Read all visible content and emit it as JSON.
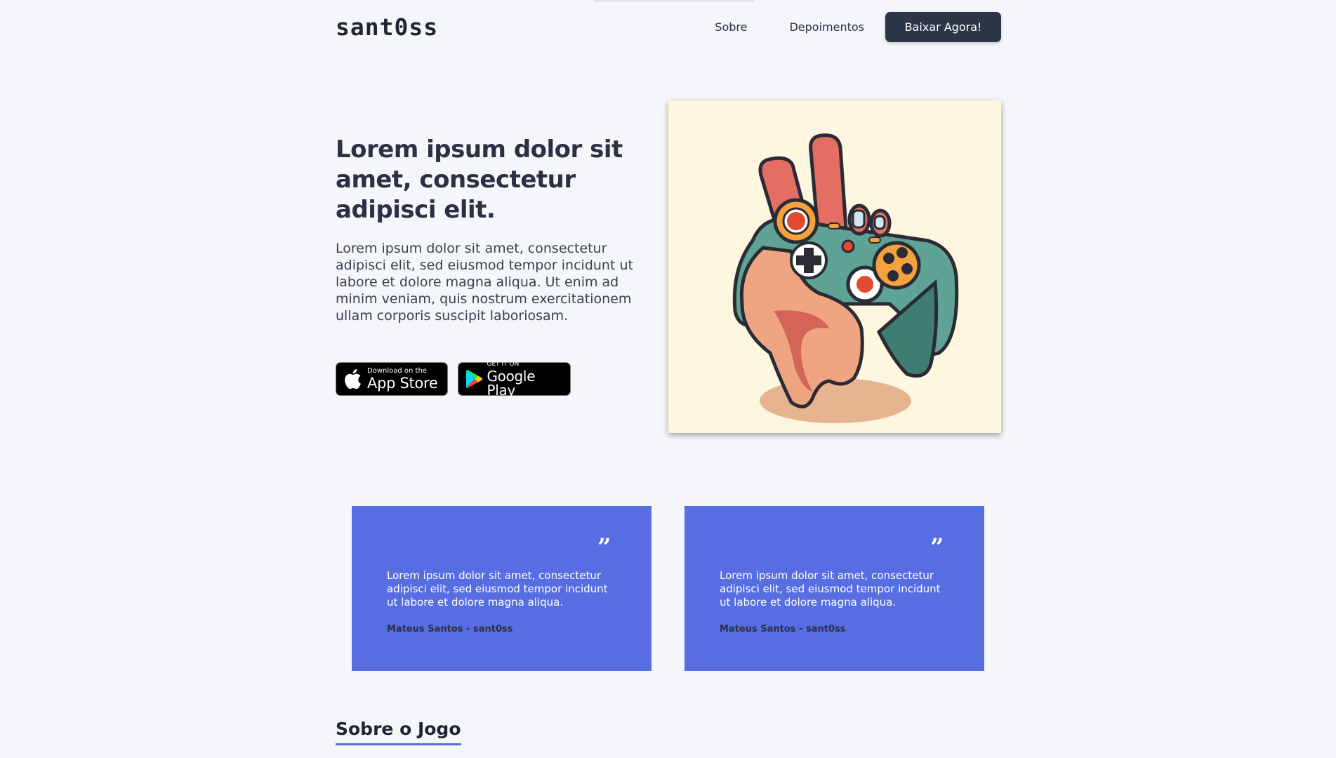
{
  "header": {
    "logo": "sant0ss",
    "nav": [
      "Sobre",
      "Depoimentos"
    ],
    "cta_label": "Baixar Agora!"
  },
  "hero": {
    "title": "Lorem ipsum dolor sit amet, consectetur adipisci elit.",
    "text": "Lorem ipsum dolor sit amet, consectetur adipisci elit, sed eiusmod tempor incidunt ut labore et dolore magna aliqua. Ut enim ad minim veniam, quis nostrum exercitationem ullam corporis suscipit laboriosam.",
    "appstore": {
      "small": "Download on the",
      "big": "App Store"
    },
    "googleplay": {
      "small": "GET IT ON",
      "big": "Google Play"
    }
  },
  "testimonials": [
    {
      "quote": "Lorem ipsum dolor sit amet, consectetur adipisci elit, sed eiusmod tempor incidunt ut labore et dolore magna aliqua.",
      "author": "Mateus Santos - sant0ss"
    },
    {
      "quote": "Lorem ipsum dolor sit amet, consectetur adipisci elit, sed eiusmod tempor incidunt ut labore et dolore magna aliqua.",
      "author": "Mateus Santos - sant0ss"
    }
  ],
  "about": {
    "title": "Sobre o Jogo"
  },
  "colors": {
    "background": "#f5f6fa",
    "cta": "#2d3548",
    "card": "#566ee2",
    "illustration_bg": "#fff6e0"
  }
}
